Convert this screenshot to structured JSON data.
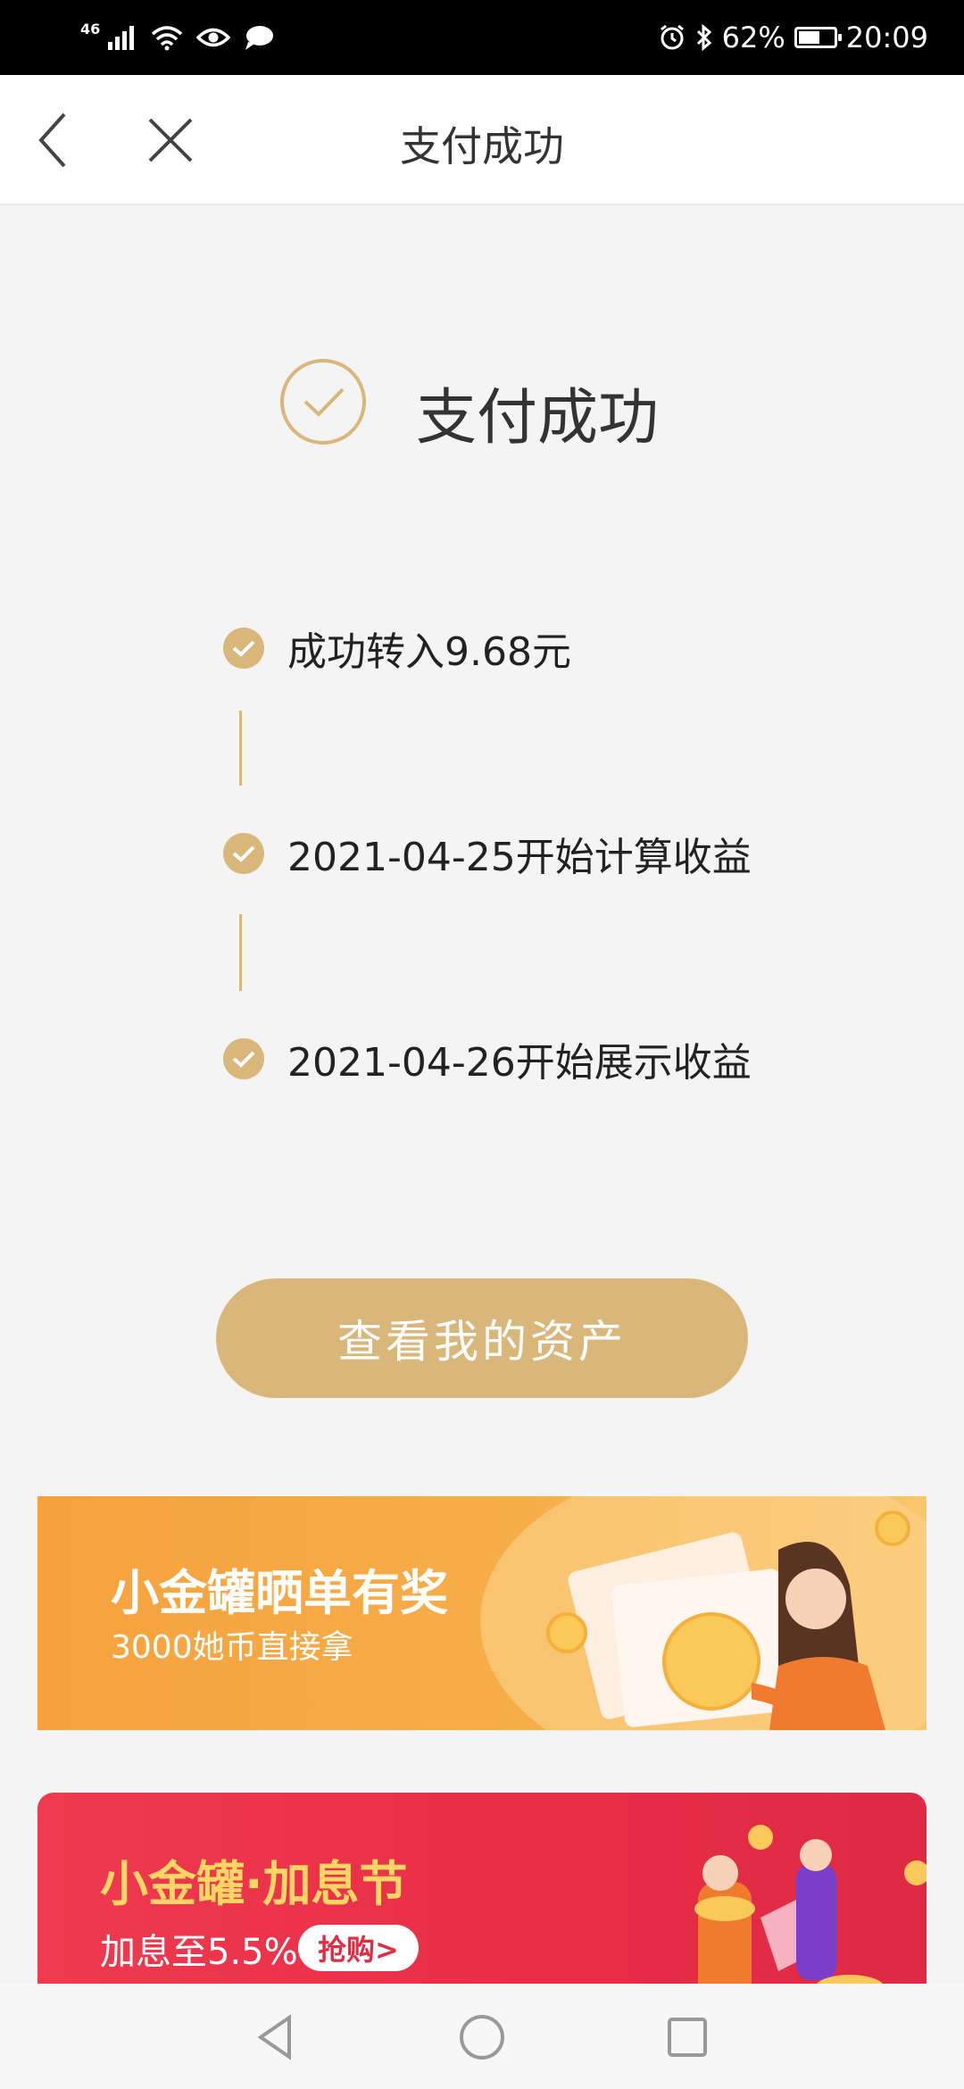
{
  "status_bar": {
    "network": "46",
    "battery_percent": "62%",
    "battery_level": 0.62,
    "time": "20:09",
    "icons": [
      "signal-icon",
      "wifi-icon",
      "eye-icon",
      "message-icon",
      "alarm-icon",
      "bluetooth-icon",
      "battery-icon"
    ]
  },
  "nav": {
    "title": "支付成功",
    "icons": [
      "back-icon",
      "close-icon"
    ]
  },
  "header": {
    "title": "支付成功"
  },
  "timeline": [
    {
      "label": "成功转入9.68元"
    },
    {
      "label": "2021-04-25开始计算收益"
    },
    {
      "label": "2021-04-26开始展示收益"
    }
  ],
  "primary_button": {
    "label": "查看我的资产"
  },
  "banners": [
    {
      "title": "小金罐晒单有奖",
      "subtitle": "3000她币直接拿"
    },
    {
      "title": "小金罐·加息节",
      "subtitle": "加息至5.5%",
      "badge": "抢购>"
    }
  ],
  "colors": {
    "accent": "#d9b67a",
    "banner_orange": "#f5a23e",
    "banner_red": "#e72d46"
  }
}
